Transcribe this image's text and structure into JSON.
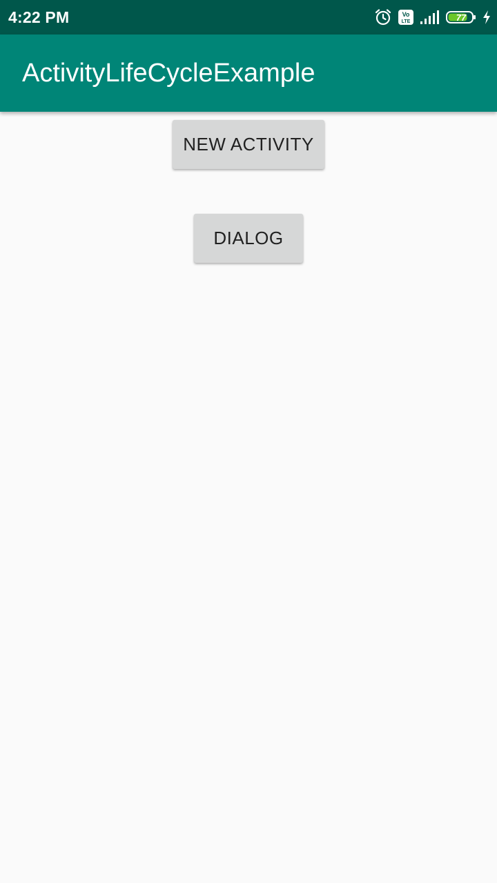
{
  "status_bar": {
    "time": "4:22 PM",
    "icons": [
      "alarm-icon",
      "volte-icon",
      "signal-icon",
      "battery-icon",
      "charging-icon"
    ],
    "battery_level": "77",
    "volte_label": "Vo LTE",
    "colors": {
      "background": "#00574b",
      "battery_fill": "#6bc72a"
    }
  },
  "app_bar": {
    "title": "ActivityLifeCycleExample",
    "color": "#008577"
  },
  "main": {
    "new_activity_label": "NEW ACTIVITY",
    "dialog_label": "DIALOG",
    "button_color": "#d6d7d7"
  }
}
